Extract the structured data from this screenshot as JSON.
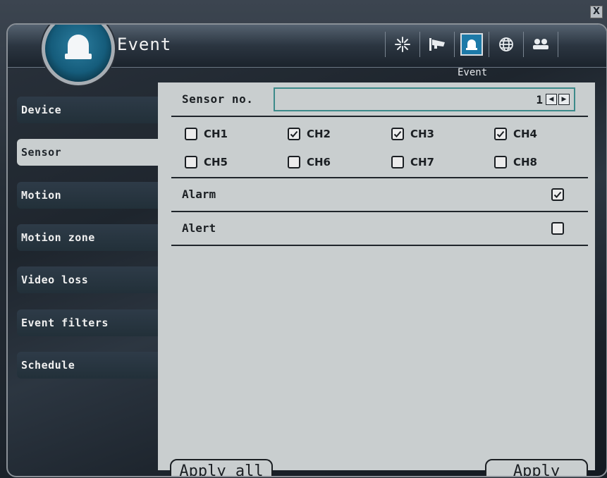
{
  "window": {
    "close_glyph": "X"
  },
  "header": {
    "title": "Event",
    "logo_icon": "alarm-bell-icon",
    "toolbar": [
      {
        "icon": "snowflake-settings-icon",
        "active": false
      },
      {
        "icon": "camera-icon",
        "active": false
      },
      {
        "icon": "alarm-bell-icon",
        "active": true
      },
      {
        "icon": "globe-icon",
        "active": false
      },
      {
        "icon": "users-icon",
        "active": false
      }
    ],
    "sub_label": "Event"
  },
  "sidebar": {
    "items": [
      {
        "label": "Device",
        "active": false
      },
      {
        "label": "Sensor",
        "active": true
      },
      {
        "label": "Motion",
        "active": false
      },
      {
        "label": "Motion zone",
        "active": false
      },
      {
        "label": "Video loss",
        "active": false
      },
      {
        "label": "Event filters",
        "active": false
      },
      {
        "label": "Schedule",
        "active": false
      }
    ]
  },
  "panel": {
    "sensor_no_label": "Sensor no.",
    "sensor_no_value": "1",
    "channels": [
      {
        "label": "CH1",
        "checked": false
      },
      {
        "label": "CH2",
        "checked": true
      },
      {
        "label": "CH3",
        "checked": true
      },
      {
        "label": "CH4",
        "checked": true
      },
      {
        "label": "CH5",
        "checked": false
      },
      {
        "label": "CH6",
        "checked": false
      },
      {
        "label": "CH7",
        "checked": false
      },
      {
        "label": "CH8",
        "checked": false
      }
    ],
    "alarm_label": "Alarm",
    "alarm_checked": true,
    "alert_label": "Alert",
    "alert_checked": false,
    "apply_all_label": "Apply all",
    "apply_label": "Apply"
  }
}
